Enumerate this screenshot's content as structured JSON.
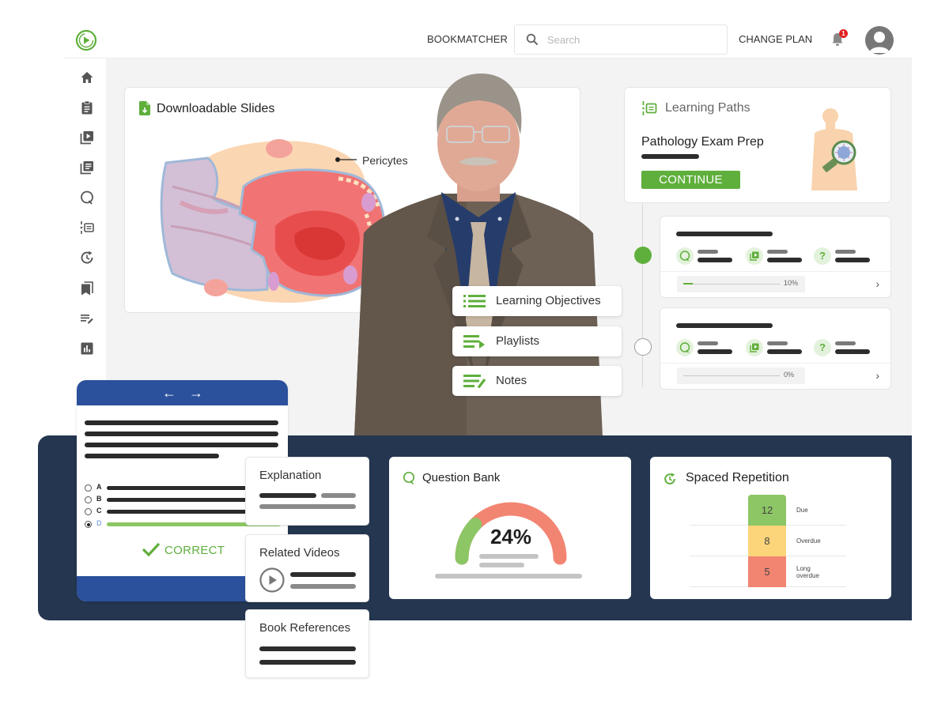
{
  "header": {
    "bookmatcher_label": "BOOKMATCHER",
    "search_placeholder": "Search",
    "change_plan_label": "CHANGE PLAN",
    "notification_count": "1"
  },
  "sidebar": {
    "items": [
      {
        "icon": "home-icon"
      },
      {
        "icon": "clipboard-icon"
      },
      {
        "icon": "video-library-icon"
      },
      {
        "icon": "book-library-icon"
      },
      {
        "icon": "question-bank-icon"
      },
      {
        "icon": "learning-paths-icon"
      },
      {
        "icon": "spaced-repetition-icon"
      },
      {
        "icon": "bookmarks-icon"
      },
      {
        "icon": "notes-icon"
      },
      {
        "icon": "analytics-icon"
      }
    ]
  },
  "slides": {
    "title": "Downloadable Slides",
    "illustration_label": "Pericytes"
  },
  "learning_paths": {
    "title": "Learning Paths",
    "path_name": "Pathology Exam Prep",
    "continue_label": "CONTINUE",
    "modules": [
      {
        "status": "started",
        "progress_percent": 10,
        "progress_label": "10%"
      },
      {
        "status": "not-started",
        "progress_percent": 0,
        "progress_label": "0%"
      }
    ]
  },
  "floating_menu": {
    "items": [
      {
        "label": "Learning Objectives",
        "icon": "list-icon"
      },
      {
        "label": "Playlists",
        "icon": "playlist-icon"
      },
      {
        "label": "Notes",
        "icon": "notes-icon"
      }
    ]
  },
  "quiz": {
    "options": [
      {
        "letter": "A",
        "selected": false
      },
      {
        "letter": "B",
        "selected": false
      },
      {
        "letter": "C",
        "selected": false
      },
      {
        "letter": "D",
        "selected": true
      }
    ],
    "result_label": "CORRECT"
  },
  "side_cards": {
    "explanation": "Explanation",
    "related_videos": "Related Videos",
    "book_references": "Book References"
  },
  "question_bank": {
    "title": "Question Bank",
    "score_percent": 24,
    "score_label": "24%",
    "colors": {
      "correct": "#8cc665",
      "incorrect": "#f28572"
    }
  },
  "spaced_repetition": {
    "title": "Spaced Repetition",
    "rows": [
      {
        "count": "12",
        "label": "Due",
        "color": "#8cc665"
      },
      {
        "count": "8",
        "label": "Overdue",
        "color": "#fcd47a"
      },
      {
        "count": "5",
        "label": "Long overdue",
        "color": "#f28572"
      }
    ]
  },
  "colors": {
    "brand_green": "#5faf3c",
    "quiz_blue": "#2b509c",
    "band_navy": "#243650"
  }
}
